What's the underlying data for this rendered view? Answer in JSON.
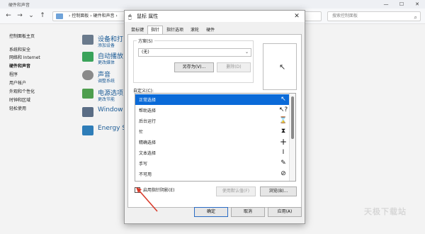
{
  "background_window": {
    "title": "硬件和声音",
    "controls": {
      "minimize": "—",
      "maximize": "☐",
      "close": "✕"
    },
    "address": "› 控制面板 › 硬件和声音 ›",
    "search_placeholder": "搜索控制面板",
    "sidebar": [
      {
        "label": "控制面板主页",
        "current": false
      },
      {
        "label": "系统和安全",
        "current": false
      },
      {
        "label": "网络和 Internet",
        "current": false
      },
      {
        "label": "硬件和声音",
        "current": true
      },
      {
        "label": "程序",
        "current": false
      },
      {
        "label": "用户帐户",
        "current": false
      },
      {
        "label": "外观和个性化",
        "current": false
      },
      {
        "label": "时钟和区域",
        "current": false
      },
      {
        "label": "轻松使用",
        "current": false
      }
    ],
    "categories": [
      {
        "title": "设备和打",
        "sub": "添加设备",
        "icon": "printer-icon",
        "color": "#6a7a8c"
      },
      {
        "title": "自动播放",
        "sub": "更改媒体",
        "icon": "autoplay-icon",
        "color": "#3aa35a"
      },
      {
        "title": "声音",
        "sub": "调整系统",
        "icon": "speaker-icon",
        "color": "#8a8a8a"
      },
      {
        "title": "电源选项",
        "sub": "更改节能",
        "icon": "battery-icon",
        "color": "#4e9e4e"
      },
      {
        "title": "Window",
        "sub": "",
        "icon": "mobility-icon",
        "color": "#5a6d85"
      },
      {
        "title": "Energy S",
        "sub": "",
        "icon": "energy-icon",
        "color": "#2e7db8"
      }
    ],
    "watermark": "天极下载站"
  },
  "dialog": {
    "title": "鼠标 属性",
    "close": "✕",
    "tabs": [
      {
        "label": "鼠标键",
        "active": false
      },
      {
        "label": "指针",
        "active": true
      },
      {
        "label": "指针选项",
        "active": false
      },
      {
        "label": "滚轮",
        "active": false
      },
      {
        "label": "硬件",
        "active": false
      }
    ],
    "scheme": {
      "legend": "方案(S)",
      "value": "(无)",
      "save_as": "另存为(V)...",
      "delete": "删除(D)"
    },
    "custom_label": "自定义(C):",
    "cursors": [
      {
        "label": "正常选择",
        "icon": "arrow-cursor-icon",
        "glyph": "↖",
        "selected": true
      },
      {
        "label": "帮助选择",
        "icon": "help-cursor-icon",
        "glyph": "↖?",
        "selected": false
      },
      {
        "label": "后台运行",
        "icon": "working-cursor-icon",
        "glyph": "⌛",
        "selected": false
      },
      {
        "label": "忙",
        "icon": "busy-cursor-icon",
        "glyph": "⧗",
        "selected": false
      },
      {
        "label": "精确选择",
        "icon": "crosshair-cursor-icon",
        "glyph": "+",
        "selected": false
      },
      {
        "label": "文本选择",
        "icon": "text-cursor-icon",
        "glyph": "I",
        "selected": false
      },
      {
        "label": "手写",
        "icon": "pen-cursor-icon",
        "glyph": "✎",
        "selected": false
      },
      {
        "label": "不可用",
        "icon": "unavailable-cursor-icon",
        "glyph": "⊘",
        "selected": false
      }
    ],
    "shadow_checkbox": {
      "label": "启用指针阴影(E)",
      "checked": false
    },
    "use_default": "使用默认值(F)",
    "browse": "浏览(B)...",
    "ok": "确定",
    "cancel": "取消",
    "apply": "应用(A)",
    "preview_cursor": "↖"
  },
  "colors": {
    "selection": "#0a6ad8",
    "link": "#1b5b96",
    "annotation": "#d83a2a"
  }
}
